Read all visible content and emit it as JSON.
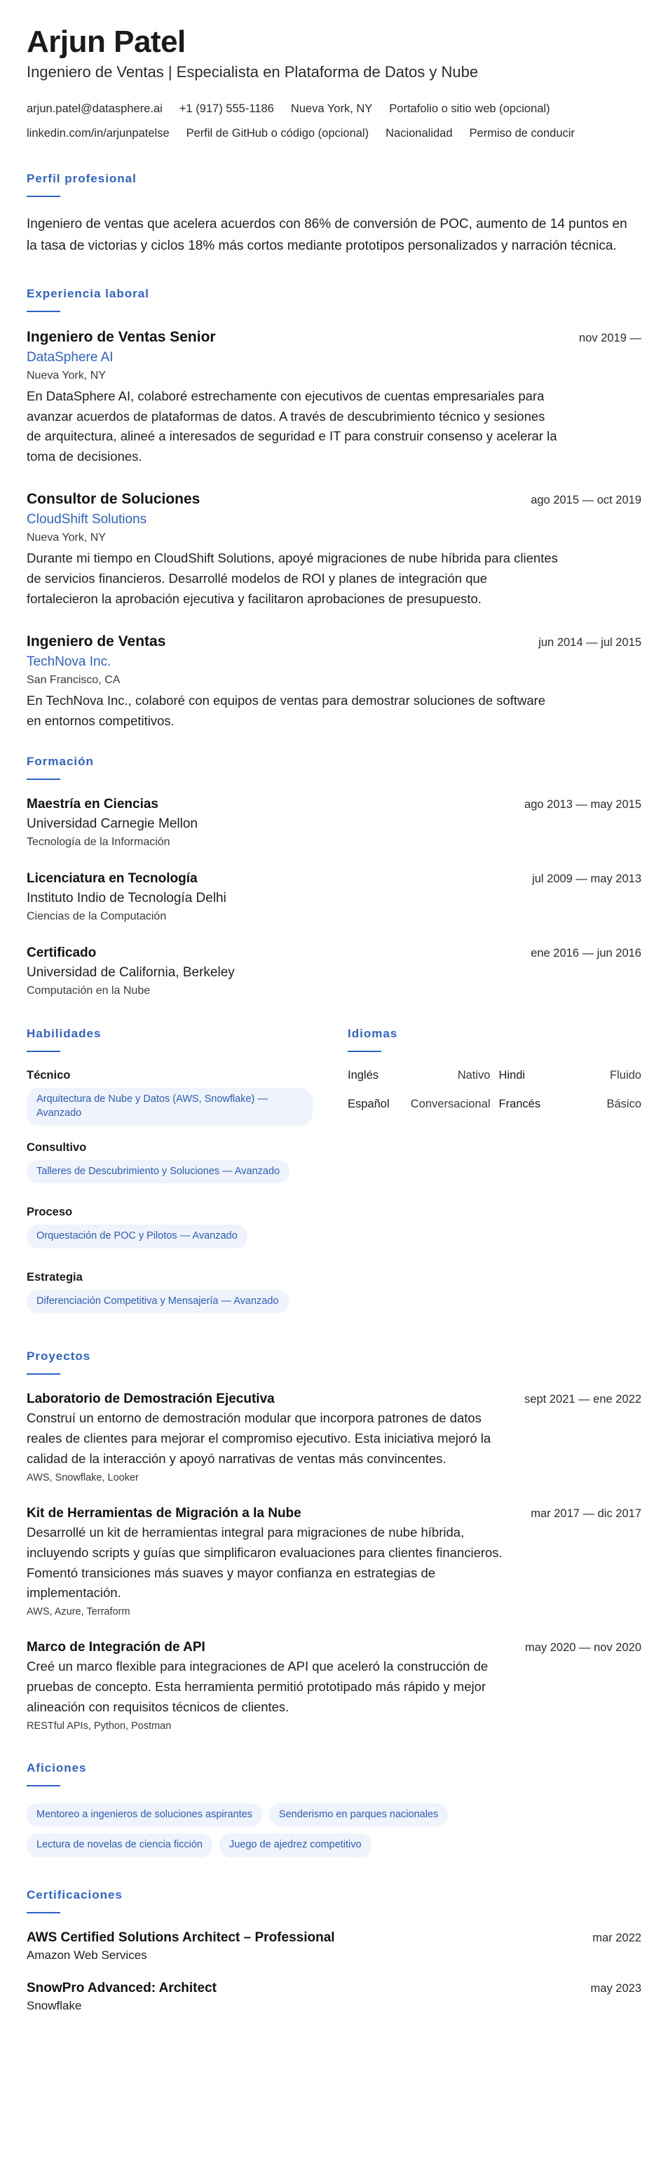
{
  "header": {
    "name": "Arjun Patel",
    "headline": "Ingeniero de Ventas | Especialista en Plataforma de Datos y Nube",
    "contact_row_1": [
      "arjun.patel@datasphere.ai",
      "+1 (917) 555-1186",
      "Nueva York, NY",
      "Portafolio o sitio web (opcional)"
    ],
    "contact_row_2": [
      "linkedin.com/in/arjunpatelse",
      "Perfil de GitHub o código (opcional)",
      "Nacionalidad",
      "Permiso de conducir"
    ]
  },
  "summary": {
    "title": "Perfil profesional",
    "text": "Ingeniero de ventas que acelera acuerdos con 86% de conversión de POC, aumento de 14 puntos en la tasa de victorias y ciclos 18% más cortos mediante prototipos personalizados y narración técnica."
  },
  "experience": {
    "title": "Experiencia laboral",
    "items": [
      {
        "role": "Ingeniero de Ventas Senior",
        "date": "nov 2019 —",
        "company": "DataSphere AI",
        "location": "Nueva York, NY",
        "description": "En DataSphere AI, colaboré estrechamente con ejecutivos de cuentas empresariales para avanzar acuerdos de plataformas de datos. A través de descubrimiento técnico y sesiones de arquitectura, alineé a interesados de seguridad e IT para construir consenso y acelerar la toma de decisiones."
      },
      {
        "role": "Consultor de Soluciones",
        "date": "ago 2015 — oct 2019",
        "company": "CloudShift Solutions",
        "location": "Nueva York, NY",
        "description": "Durante mi tiempo en CloudShift Solutions, apoyé migraciones de nube híbrida para clientes de servicios financieros. Desarrollé modelos de ROI y planes de integración que fortalecieron la aprobación ejecutiva y facilitaron aprobaciones de presupuesto."
      },
      {
        "role": "Ingeniero de Ventas",
        "date": "jun 2014 — jul 2015",
        "company": "TechNova Inc.",
        "location": "San Francisco, CA",
        "description": "En TechNova Inc., colaboré con equipos de ventas para demostrar soluciones de software en entornos competitivos."
      }
    ]
  },
  "education": {
    "title": "Formación",
    "items": [
      {
        "degree": "Maestría en Ciencias",
        "date": "ago 2013 — may 2015",
        "school": "Universidad Carnegie Mellon",
        "field": "Tecnología de la Información"
      },
      {
        "degree": "Licenciatura en Tecnología",
        "date": "jul 2009 — may 2013",
        "school": "Instituto Indio de Tecnología Delhi",
        "field": "Ciencias de la Computación"
      },
      {
        "degree": "Certificado",
        "date": "ene 2016 — jun 2016",
        "school": "Universidad de California, Berkeley",
        "field": "Computación en la Nube"
      }
    ]
  },
  "skills": {
    "title": "Habilidades",
    "groups": [
      {
        "name": "Técnico",
        "chip": "Arquitectura de Nube y Datos (AWS, Snowflake) — Avanzado"
      },
      {
        "name": "Consultivo",
        "chip": "Talleres de Descubrimiento y Soluciones — Avanzado"
      },
      {
        "name": "Proceso",
        "chip": "Orquestación de POC y Pilotos — Avanzado"
      },
      {
        "name": "Estrategia",
        "chip": "Diferenciación Competitiva y Mensajería — Avanzado"
      }
    ]
  },
  "languages": {
    "title": "Idiomas",
    "items": [
      {
        "name": "Inglés",
        "level": "Nativo"
      },
      {
        "name": "Hindi",
        "level": "Fluido"
      },
      {
        "name": "Español",
        "level": "Conversacional"
      },
      {
        "name": "Francés",
        "level": "Básico"
      }
    ]
  },
  "projects": {
    "title": "Proyectos",
    "items": [
      {
        "name": "Laboratorio de Demostración Ejecutiva",
        "date": "sept 2021 — ene 2022",
        "description": "Construí un entorno de demostración modular que incorpora patrones de datos reales de clientes para mejorar el compromiso ejecutivo. Esta iniciativa mejoró la calidad de la interacción y apoyó narrativas de ventas más convincentes.",
        "tech": "AWS, Snowflake, Looker"
      },
      {
        "name": "Kit de Herramientas de Migración a la Nube",
        "date": "mar 2017 — dic 2017",
        "description": "Desarrollé un kit de herramientas integral para migraciones de nube híbrida, incluyendo scripts y guías que simplificaron evaluaciones para clientes financieros. Fomentó transiciones más suaves y mayor confianza en estrategias de implementación.",
        "tech": "AWS, Azure, Terraform"
      },
      {
        "name": "Marco de Integración de API",
        "date": "may 2020 — nov 2020",
        "description": "Creé un marco flexible para integraciones de API que aceleró la construcción de pruebas de concepto. Esta herramienta permitió prototipado más rápido y mejor alineación con requisitos técnicos de clientes.",
        "tech": "RESTful APIs, Python, Postman"
      }
    ]
  },
  "hobbies": {
    "title": "Aficiones",
    "items": [
      "Mentoreo a ingenieros de soluciones aspirantes",
      "Senderismo en parques nacionales",
      "Lectura de novelas de ciencia ficción",
      "Juego de ajedrez competitivo"
    ]
  },
  "certifications": {
    "title": "Certificaciones",
    "items": [
      {
        "name": "AWS Certified Solutions Architect – Professional",
        "date": "mar 2022",
        "issuer": "Amazon Web Services"
      },
      {
        "name": "SnowPro Advanced: Architect",
        "date": "may 2023",
        "issuer": "Snowflake"
      }
    ]
  },
  "colors": {
    "accent": "#2f62c8",
    "chip_bg": "#eef3fc",
    "text": "#1a1a1a"
  }
}
